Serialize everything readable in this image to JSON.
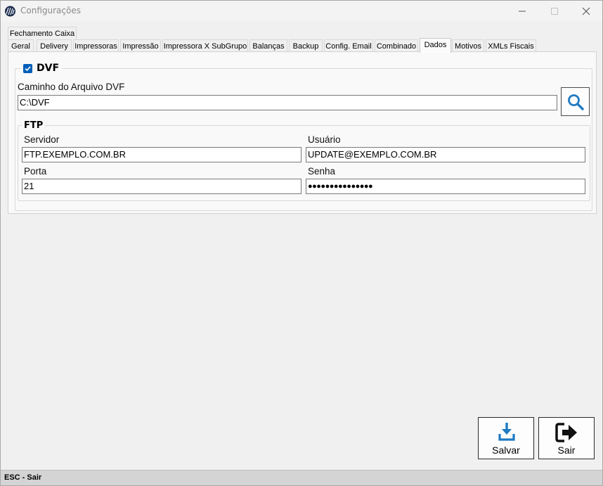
{
  "window": {
    "title": "Configurações",
    "icon": "app-logo-icon",
    "controls": [
      "minimize-icon",
      "maximize-icon",
      "close-icon"
    ]
  },
  "tabs": {
    "row_top": [
      "Fechamento Caixa"
    ],
    "row_bottom": [
      "Geral",
      "Delivery",
      "Impressoras",
      "Impressão",
      "Impressora X SubGrupo",
      "Balanças",
      "Backup",
      "Config. Email",
      "Combinado",
      "Dados",
      "Motivos",
      "XMLs Fiscais"
    ],
    "active": "Dados"
  },
  "dvf": {
    "legend": "DVF",
    "checked": true,
    "path_label": "Caminho do Arquivo DVF",
    "path_value": "C:\\DVF",
    "search_icon": "search-icon"
  },
  "ftp": {
    "legend": "FTP",
    "server_label": "Servidor",
    "server_value": "FTP.EXEMPLO.COM.BR",
    "user_label": "Usuário",
    "user_value": "UPDATE@EXEMPLO.COM.BR",
    "port_label": "Porta",
    "port_value": "21",
    "password_label": "Senha",
    "password_value": "●●●●●●●●●●●●●●●"
  },
  "actions": {
    "save_label": "Salvar",
    "save_icon": "download-icon",
    "exit_label": "Sair",
    "exit_icon": "exit-arrow-icon"
  },
  "status": {
    "text": "ESC - Sair"
  },
  "colors": {
    "accent": "#005fb8",
    "icon_blue": "#1f7ac2",
    "status_bg": "#d4d4d4"
  }
}
